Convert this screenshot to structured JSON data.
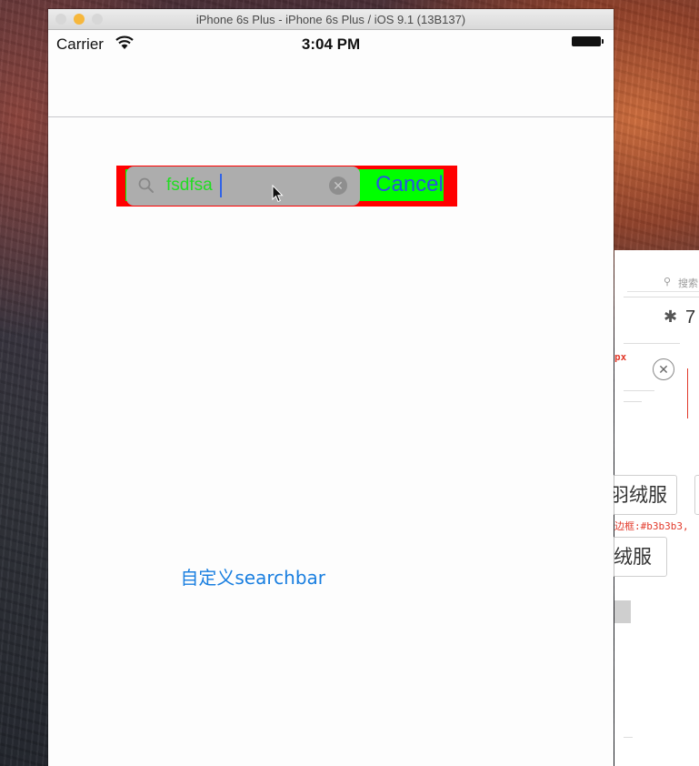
{
  "window": {
    "title": "iPhone 6s Plus - iPhone 6s Plus / iOS 9.1 (13B137)"
  },
  "status_bar": {
    "carrier": "Carrier",
    "time": "3:04 PM"
  },
  "search_bar": {
    "value": "fsdfsa",
    "cancel_label": "Cancel",
    "colors": {
      "container": "#ff0000",
      "inner": "#00ff00",
      "field": "#adadad",
      "text": "#22dd22",
      "cancel": "#2a52e0"
    }
  },
  "main": {
    "link_label": "自定义searchbar"
  },
  "background_window": {
    "search_placeholder": "搜索",
    "number": "7",
    "px_label": "px",
    "tag1": "羽绒服",
    "tag2": "绒服",
    "border_note": "边框:#b3b3b3,"
  },
  "icons": {
    "wifi": "wifi-icon",
    "battery": "battery-icon",
    "search": "search-icon",
    "clear": "clear-icon",
    "cursor": "mouse-cursor-icon",
    "bluetooth": "bluetooth-icon"
  }
}
